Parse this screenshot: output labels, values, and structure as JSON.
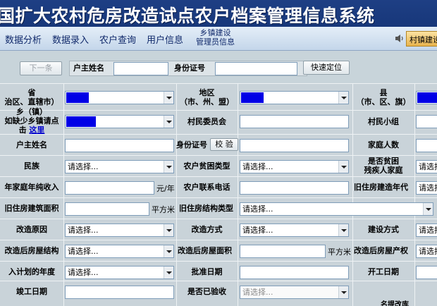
{
  "title": "国扩大农村危房改造试点农户档案管理信息系统",
  "menu": {
    "items": [
      "数据分析",
      "数据录入",
      "农户查询",
      "用户信息"
    ],
    "township_line1": "乡镇建设",
    "township_line2": "管理员信息",
    "tag": "村镇建设"
  },
  "search": {
    "prev_label": "下一条",
    "name_label": "户主姓名",
    "name_value": "",
    "id_label": "身份证号",
    "id_value": "",
    "locate_label": "快速定位"
  },
  "form": {
    "province_l1": "省",
    "province_l2": "治区、直辖市）",
    "region_l1": "地区",
    "region_l2": "（市、州、盟）",
    "county_l1": "县",
    "county_l2": "（市、区、旗）",
    "township_l1": "乡（镇）",
    "township_l2": "如缺少乡镇请点",
    "township_l3": "击",
    "township_link": "这里",
    "village_committee": "村民委员会",
    "village_group": "村民小组",
    "householder_name": "户主姓名",
    "id_number": "身份证号",
    "verify": "校 验",
    "family_size": "家庭人数",
    "ethnicity": "民族",
    "poverty_type": "农户贫困类型",
    "disabled_l1": "是否贫困",
    "disabled_l2": "残疾人家庭",
    "income": "年家庭年纯收入",
    "income_unit": "元/年",
    "phone": "农户联系电话",
    "old_year": "旧住房建造年代",
    "old_area": "旧住房建筑面积",
    "area_unit": "平方米",
    "old_structure": "旧住房结构类型",
    "reason": "改造原因",
    "method": "改造方式",
    "build_method": "建设方式",
    "new_structure": "改造后房屋结构",
    "new_area": "改造后房屋面积",
    "new_area_unit": "平方米",
    "property": "改造后房屋产权",
    "plan_year": "入计划的年度",
    "approve_date": "批准日期",
    "start_date": "开工日期",
    "finish_date": "竣工日期",
    "accepted": "是否已验收",
    "placeholder": "请选择...",
    "cutoff_label": "名提改库"
  }
}
